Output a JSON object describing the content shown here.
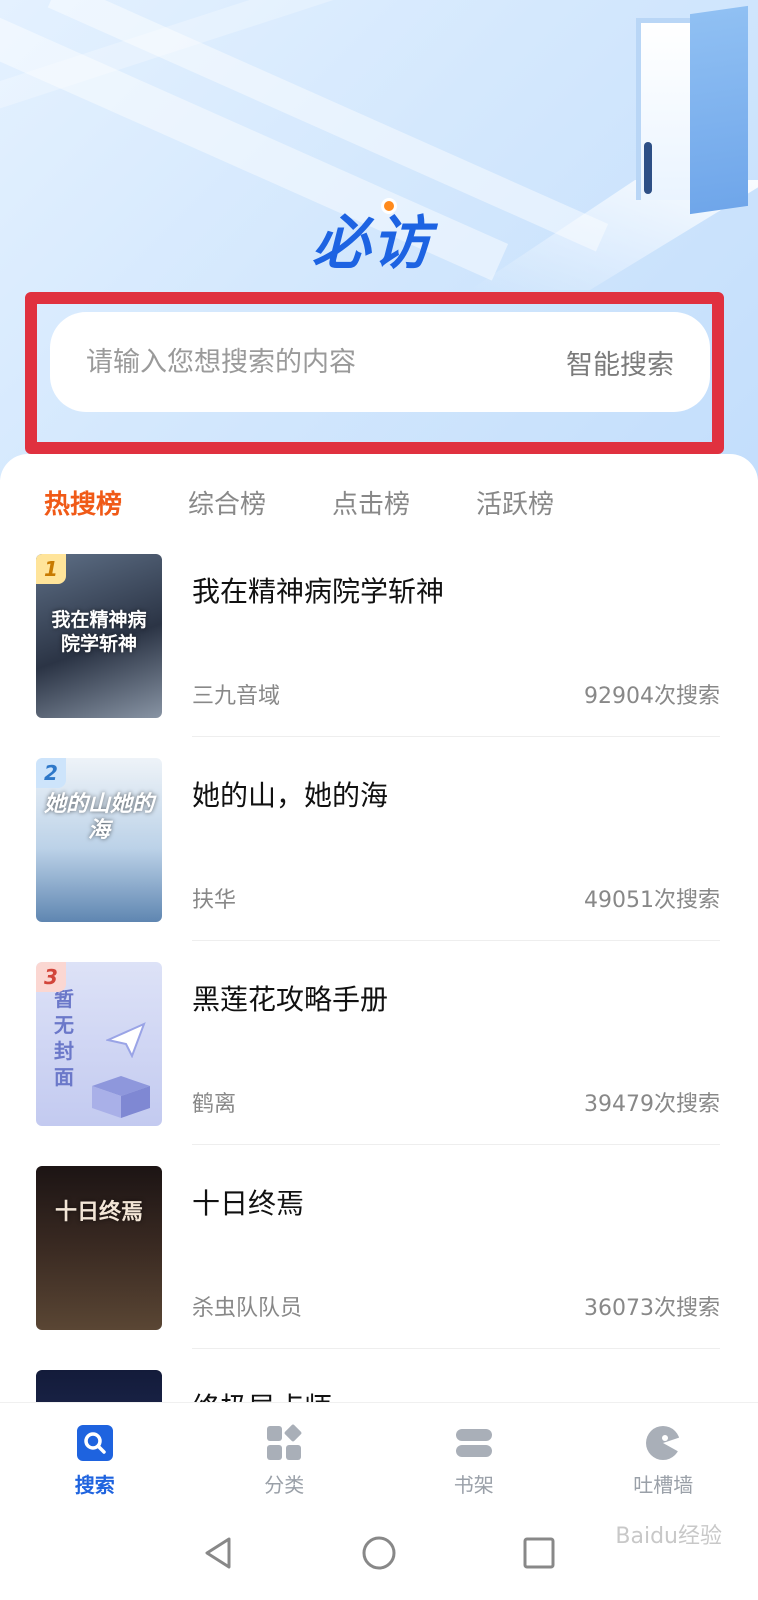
{
  "app": {
    "logo_text": "必访"
  },
  "search": {
    "placeholder": "请输入您想搜索的内容",
    "button_label": "智能搜索"
  },
  "tabs": [
    {
      "label": "热搜榜",
      "active": true
    },
    {
      "label": "综合榜",
      "active": false
    },
    {
      "label": "点击榜",
      "active": false
    },
    {
      "label": "活跃榜",
      "active": false
    }
  ],
  "books": [
    {
      "rank": "1",
      "title": "我在精神病院学斩神",
      "author": "三九音域",
      "count": "92904次搜索",
      "cover_text": "我在精神病院学斩神"
    },
    {
      "rank": "2",
      "title": "她的山，她的海",
      "author": "扶华",
      "count": "49051次搜索",
      "cover_text": "她的山她的海"
    },
    {
      "rank": "3",
      "title": "黑莲花攻略手册",
      "author": "鹤离",
      "count": "39479次搜索",
      "cover_text": "暂无封面"
    },
    {
      "rank": "",
      "title": "十日终焉",
      "author": "杀虫队队员",
      "count": "36073次搜索",
      "cover_text": "十日终焉"
    },
    {
      "rank": "",
      "title": "终极异点师",
      "author": "",
      "count": "",
      "cover_text": ""
    }
  ],
  "nav": [
    {
      "label": "搜索",
      "icon": "search-icon",
      "active": true
    },
    {
      "label": "分类",
      "icon": "category-icon",
      "active": false
    },
    {
      "label": "书架",
      "icon": "bookshelf-icon",
      "active": false
    },
    {
      "label": "吐槽墙",
      "icon": "comment-wall-icon",
      "active": false
    }
  ],
  "colors": {
    "accent": "#1e63df",
    "hot_tab": "#f05a17",
    "highlight_border": "#e0313f"
  },
  "watermark": "Baidu经验"
}
